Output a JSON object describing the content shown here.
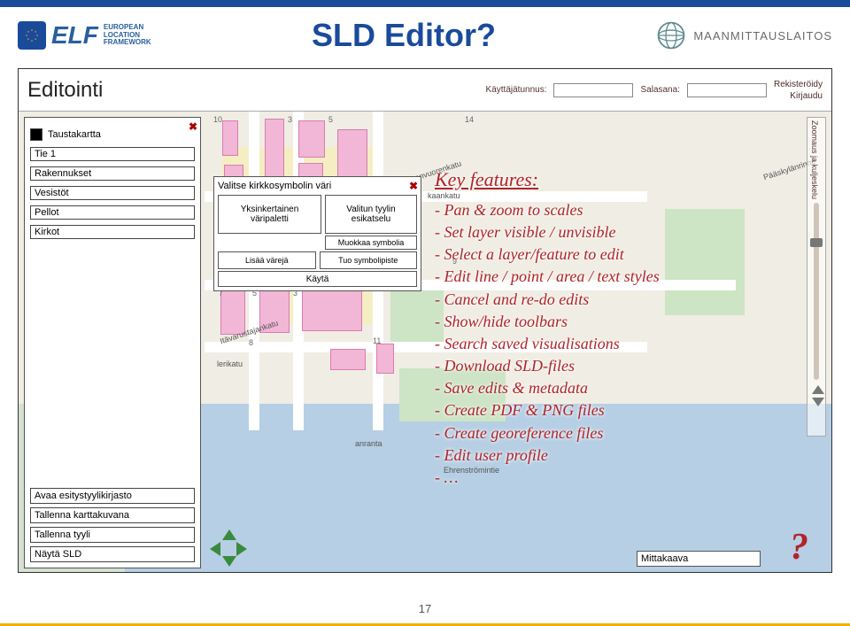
{
  "header": {
    "elf_abbrev": "ELF",
    "elf_full_1": "EUROPEAN",
    "elf_full_2": "LOCATION",
    "elf_full_3": "FRAMEWORK",
    "slide_title": "SLD Editor?",
    "mml_name": "MAANMITTAUSLAITOS"
  },
  "app": {
    "title": "Editointi",
    "login": {
      "user_label": "Käyttäjätunnus:",
      "pass_label": "Salasana:",
      "register": "Rekisteröidy",
      "login": "Kirjaudu"
    },
    "layers": {
      "items": [
        {
          "label": "Taustakartta",
          "swatch": "#000"
        },
        {
          "label": "Tie 1"
        },
        {
          "label": "Rakennukset"
        },
        {
          "label": "Vesistöt"
        },
        {
          "label": "Pellot"
        },
        {
          "label": "Kirkot"
        }
      ],
      "buttons": {
        "open_lib": "Avaa esitystyylikirjasto",
        "save_map": "Tallenna karttakuvana",
        "save_style": "Tallenna tyyli",
        "show_sld": "Näytä SLD"
      }
    },
    "color_panel": {
      "title": "Valitse kirkkosymbolin väri",
      "simple_palette": "Yksinkertainen väripaletti",
      "style_preview": "Valitun tyylin esikatselu",
      "edit_symbol": "Muokkaa symbolia",
      "add_colors": "Lisää värejä",
      "import_symbol": "Tuo symbolipiste",
      "apply": "Käytä"
    },
    "zoom_label": "Zoomaus ja kuljeskelu",
    "scale_label": "Mittakaava",
    "map_labels": {
      "street1": "Vilhonvuorenkatu",
      "street2": "Itävarustajankatu",
      "street3": "Ehrenströmintie",
      "street4": "lerikatu",
      "street5": "kaankatu",
      "street6": "Pääskylänrinne",
      "street7": "anranta"
    }
  },
  "features": {
    "heading": "Key features:",
    "items": [
      "- Pan & zoom to scales",
      "- Set layer visible / unvisible",
      "- Select a layer/feature to edit",
      "- Edit line / point / area / text styles",
      "- Cancel and re-do edits",
      "- Show/hide toolbars",
      "- Search saved visualisations",
      "- Download SLD-files",
      "- Save edits & metadata",
      "- Create PDF & PNG files",
      "- Create georeference files",
      "- Edit user profile",
      "- …"
    ]
  },
  "page_number": "17",
  "qmark": "?"
}
